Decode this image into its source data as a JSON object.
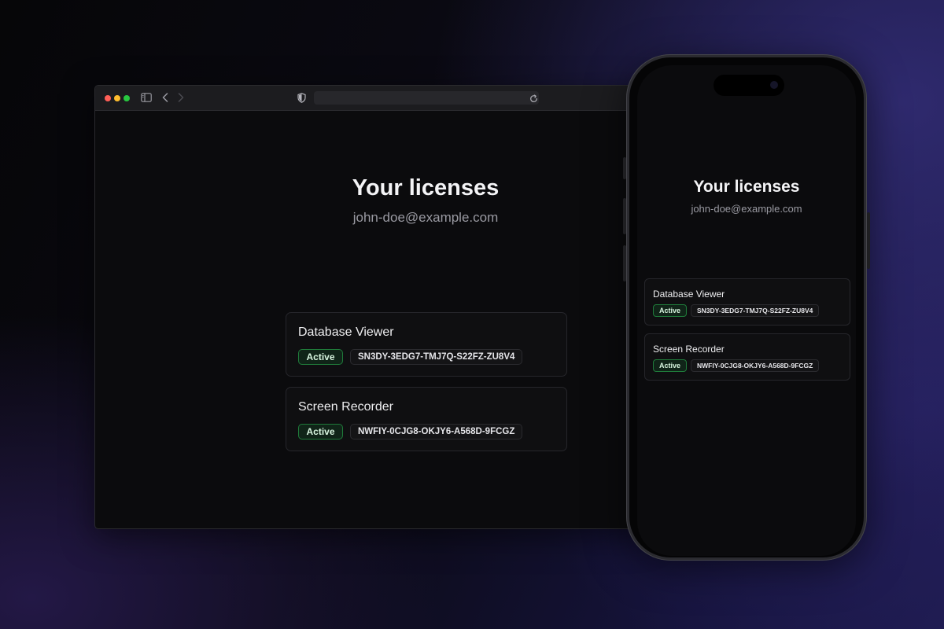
{
  "page": {
    "title": "Your licenses",
    "email": "john-doe@example.com"
  },
  "browser": {
    "icons": {
      "sidebar": "sidebar-icon",
      "back": "chevron-left-icon",
      "forward": "chevron-right-icon",
      "privacy": "shield-icon",
      "reload": "reload-icon"
    },
    "address": ""
  },
  "licenses": [
    {
      "product": "Database Viewer",
      "status": "Active",
      "key": "SN3DY-3EDG7-TMJ7Q-S22FZ-ZU8V4"
    },
    {
      "product": "Screen Recorder",
      "status": "Active",
      "key": "NWFIY-0CJG8-OKJY6-A568D-9FCGZ"
    }
  ],
  "colors": {
    "status_active_border": "#1f7a3a",
    "status_active_bg": "#102418"
  }
}
